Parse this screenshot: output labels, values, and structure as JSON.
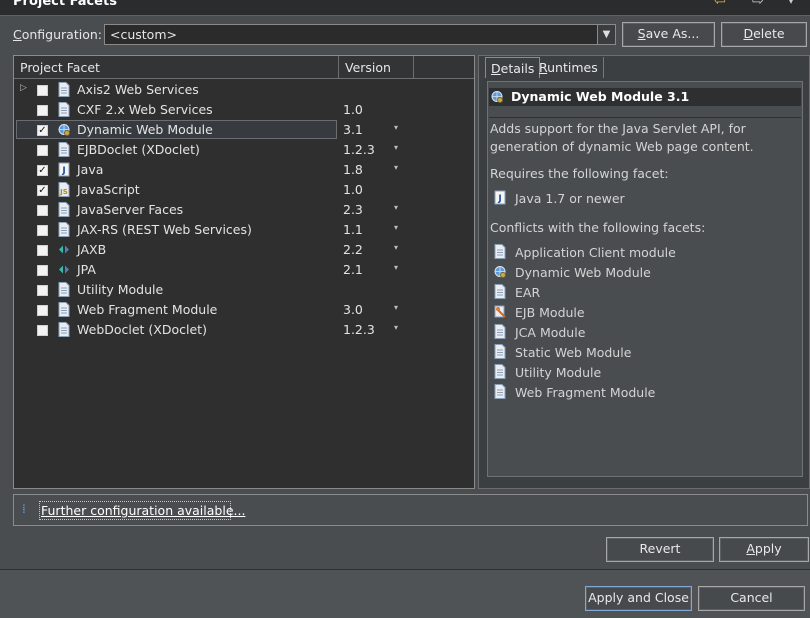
{
  "header": {
    "title": "Project Facets",
    "nav": {
      "back_icon": "arrow-back-icon",
      "forward_icon": "arrow-forward-icon",
      "menu_icon": "view-menu-icon"
    }
  },
  "config": {
    "label": "Configuration:",
    "value": "<custom>",
    "save_as_label": "Save As...",
    "delete_label": "Delete"
  },
  "table": {
    "columns": [
      "Project Facet",
      "Version"
    ],
    "rows": [
      {
        "name": "Axis2 Web Services",
        "version": "",
        "checked": false,
        "expandable": true,
        "has_dropdown": false,
        "icon": "page-icon"
      },
      {
        "name": "CXF 2.x Web Services",
        "version": "1.0",
        "checked": false,
        "expandable": false,
        "has_dropdown": false,
        "icon": "page-icon"
      },
      {
        "name": "Dynamic Web Module",
        "version": "3.1",
        "checked": true,
        "expandable": false,
        "has_dropdown": true,
        "icon": "globe-gear-icon",
        "selected": true
      },
      {
        "name": "EJBDoclet (XDoclet)",
        "version": "1.2.3",
        "checked": false,
        "expandable": false,
        "has_dropdown": true,
        "icon": "page-icon"
      },
      {
        "name": "Java",
        "version": "1.8",
        "checked": true,
        "expandable": false,
        "has_dropdown": true,
        "icon": "java-icon"
      },
      {
        "name": "JavaScript",
        "version": "1.0",
        "checked": true,
        "expandable": false,
        "has_dropdown": false,
        "icon": "javascript-icon"
      },
      {
        "name": "JavaServer Faces",
        "version": "2.3",
        "checked": false,
        "expandable": false,
        "has_dropdown": true,
        "icon": "page-icon"
      },
      {
        "name": "JAX-RS (REST Web Services)",
        "version": "1.1",
        "checked": false,
        "expandable": false,
        "has_dropdown": true,
        "icon": "page-icon"
      },
      {
        "name": "JAXB",
        "version": "2.2",
        "checked": false,
        "expandable": false,
        "has_dropdown": true,
        "icon": "jaxb-icon"
      },
      {
        "name": "JPA",
        "version": "2.1",
        "checked": false,
        "expandable": false,
        "has_dropdown": true,
        "icon": "jaxb-icon"
      },
      {
        "name": "Utility Module",
        "version": "",
        "checked": false,
        "expandable": false,
        "has_dropdown": false,
        "icon": "page-icon"
      },
      {
        "name": "Web Fragment Module",
        "version": "3.0",
        "checked": false,
        "expandable": false,
        "has_dropdown": true,
        "icon": "page-icon"
      },
      {
        "name": "WebDoclet (XDoclet)",
        "version": "1.2.3",
        "checked": false,
        "expandable": false,
        "has_dropdown": true,
        "icon": "page-icon"
      }
    ]
  },
  "details": {
    "tabs": [
      "Details",
      "Runtimes"
    ],
    "title": "Dynamic Web Module 3.1",
    "description_lines": [
      "Adds support for the Java Servlet API, for",
      "generation of dynamic Web page content."
    ],
    "requires_heading": "Requires the following facet:",
    "requires": [
      {
        "label": "Java 1.7 or newer",
        "icon": "java-icon"
      }
    ],
    "conflicts_heading": "Conflicts with the following facets:",
    "conflicts": [
      {
        "label": "Application Client module",
        "icon": "page-icon"
      },
      {
        "label": "Dynamic Web Module",
        "icon": "globe-gear-icon"
      },
      {
        "label": "EAR",
        "icon": "page-icon"
      },
      {
        "label": "EJB Module",
        "icon": "ejb-icon"
      },
      {
        "label": "JCA Module",
        "icon": "page-icon"
      },
      {
        "label": "Static Web Module",
        "icon": "page-icon"
      },
      {
        "label": "Utility Module",
        "icon": "page-icon"
      },
      {
        "label": "Web Fragment Module",
        "icon": "page-icon"
      }
    ]
  },
  "further": {
    "label": "Further configuration available...",
    "icon": "info-icon"
  },
  "buttons": {
    "revert": "Revert",
    "apply": "Apply",
    "apply_close": "Apply and Close",
    "cancel": "Cancel"
  }
}
